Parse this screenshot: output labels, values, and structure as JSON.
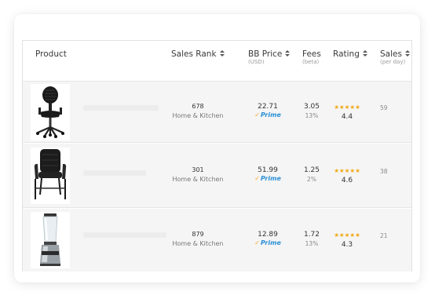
{
  "columns": {
    "product": "Product",
    "sales_rank": "Sales Rank",
    "bb_price": "BB Price",
    "bb_price_sub": "(USD)",
    "fees": "Fees",
    "fees_sub": "(beta)",
    "rating": "Rating",
    "sales": "Sales",
    "sales_sub": "(per day)"
  },
  "rows": [
    {
      "image": "office-chair",
      "rank": "678",
      "category": "Home & Kitchen",
      "price": "22.71",
      "prime": "Prime",
      "fee": "3.05",
      "fee_pct": "13%",
      "stars": "★★★★★",
      "rating": "4.4",
      "sales": "59"
    },
    {
      "image": "leather-guest-chair",
      "rank": "301",
      "category": "Home & Kitchen",
      "price": "51.99",
      "prime": "Prime",
      "fee": "1.25",
      "fee_pct": "2%",
      "stars": "★★★★★",
      "rating": "4.6",
      "sales": "38"
    },
    {
      "image": "blender",
      "rank": "879",
      "category": "Home & Kitchen",
      "price": "12.89",
      "prime": "Prime",
      "fee": "1.72",
      "fee_pct": "13%",
      "stars": "★★★★★",
      "rating": "4.3",
      "sales": "21"
    }
  ],
  "colors": {
    "prime_blue": "#2b8fd6",
    "star": "#f0a818",
    "row_bg": "#f5f5f5"
  }
}
